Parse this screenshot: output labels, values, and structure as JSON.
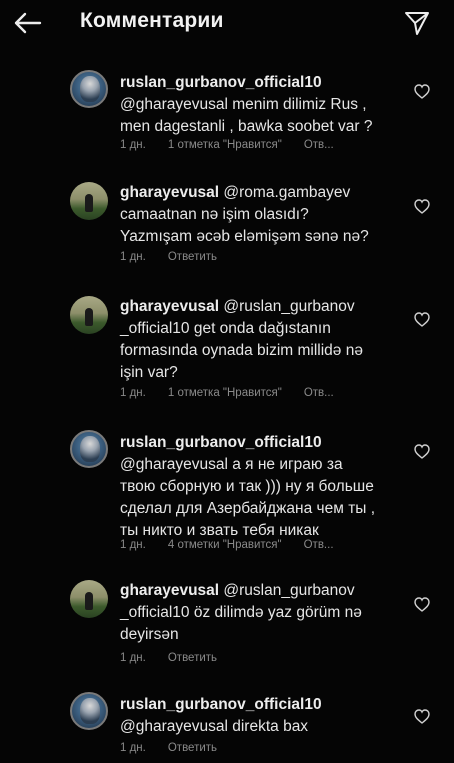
{
  "header": {
    "title": "Комментарии",
    "back_icon": "arrow-left-icon",
    "send_icon": "paper-plane-icon"
  },
  "comments": [
    {
      "username": "ruslan_gurbanov_official10",
      "lines": [
        "@gharayevusal menim dilimiz Rus ,",
        "men dagestanli , bawka soobet var ?"
      ],
      "time": "1 дн.",
      "likes": "1 отметка \"Нравится\"",
      "reply": "Отв..."
    },
    {
      "username": "gharayevusal",
      "lines": [
        "@roma.gambayev",
        "camaatnan nə işim olasıdı?",
        "Yazmışam əcəb eləmişəm sənə nə?"
      ],
      "time": "1 дн.",
      "likes": "",
      "reply": "Ответить"
    },
    {
      "username": "gharayevusal",
      "lines": [
        "@ruslan_gurbanov",
        "_official10 get onda dağıstanın",
        "formasında oynada  bizim millidə nə",
        "işin var?"
      ],
      "time": "1 дн.",
      "likes": "1 отметка \"Нравится\"",
      "reply": "Отв..."
    },
    {
      "username": "ruslan_gurbanov_official10",
      "lines": [
        "@gharayevusal а я не играю за",
        "твою сборную и так ))) ну я больше",
        "сделал для Азербайджана чем ты ,",
        "ты никто и звать тебя никак"
      ],
      "time": "1 дн.",
      "likes": "4 отметки \"Нравится\"",
      "reply": "Отв..."
    },
    {
      "username": "gharayevusal",
      "lines": [
        "@ruslan_gurbanov",
        "_official10 öz dilimdə yaz görüm nə",
        "deyirsən"
      ],
      "time": "1 дн.",
      "likes": "",
      "reply": "Ответить"
    },
    {
      "username": "ruslan_gurbanov_official10",
      "lines": [
        "@gharayevusal direkta bax"
      ],
      "time": "1 дн.",
      "likes": "",
      "reply": "Ответить"
    }
  ]
}
